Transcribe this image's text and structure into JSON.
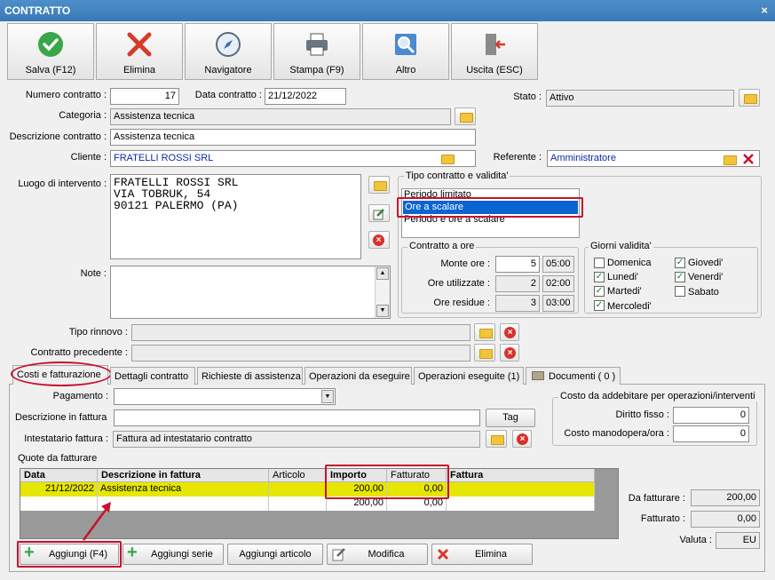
{
  "window": {
    "title": "CONTRATTO",
    "close": "×"
  },
  "toolbar": {
    "save": "Salva (F12)",
    "delete": "Elimina",
    "navigator": "Navigatore",
    "print": "Stampa (F9)",
    "other": "Altro",
    "exit": "Uscita (ESC)"
  },
  "form": {
    "numero_label": "Numero contratto :",
    "numero_value": "17",
    "data_label": "Data contratto :",
    "data_value": "21/12/2022",
    "stato_label": "Stato :",
    "stato_value": "Attivo",
    "categoria_label": "Categoria :",
    "categoria_value": "Assistenza tecnica",
    "descrizione_label": "Descrizione contratto :",
    "descrizione_value": "Assistenza tecnica",
    "cliente_label": "Cliente :",
    "cliente_value": "FRATELLI ROSSI SRL",
    "referente_label": "Referente :",
    "referente_value": "Amministratore",
    "luogo_label": "Luogo di intervento :",
    "luogo_lines": [
      "FRATELLI ROSSI SRL",
      "VIA TOBRUK, 54",
      "90121 PALERMO (PA)"
    ],
    "note_label": "Note :",
    "tipo_rinnovo_label": "Tipo rinnovo :",
    "contratto_precedente_label": "Contratto precedente :"
  },
  "tipo_contratto": {
    "title": "Tipo contratto e validita'",
    "options": [
      "Periodo limitato",
      "Ore a scalare",
      "Periodo e ore a scalare"
    ],
    "selected": "Ore a scalare"
  },
  "contratto_ore": {
    "title": "Contratto a ore",
    "monte_label": "Monte ore :",
    "monte_value": "5",
    "monte_time": "05:00",
    "utilizzate_label": "Ore utilizzate :",
    "utilizzate_value": "2",
    "utilizzate_time": "02:00",
    "residue_label": "Ore residue :",
    "residue_value": "3",
    "residue_time": "03:00"
  },
  "giorni": {
    "title": "Giorni validita'",
    "days": [
      {
        "label": "Domenica",
        "checked": false
      },
      {
        "label": "Lunedi'",
        "checked": true
      },
      {
        "label": "Martedi'",
        "checked": true
      },
      {
        "label": "Mercoledi'",
        "checked": true
      },
      {
        "label": "Giovedi'",
        "checked": true
      },
      {
        "label": "Venerdi'",
        "checked": true
      },
      {
        "label": "Sabato",
        "checked": false
      }
    ],
    "check_mark": "✓"
  },
  "tabs": [
    "Costi e fatturazione",
    "Dettagli contratto",
    "Richieste di assistenza",
    "Operazioni da eseguire",
    "Operazioni eseguite (1)",
    "Documenti ( 0 )"
  ],
  "billing": {
    "pagamento_label": "Pagamento :",
    "descrizione_label": "Descrizione in fattura",
    "tag_button": "Tag",
    "intestatario_label": "Intestatario fattura :",
    "intestatario_value": "Fattura ad intestatario contratto",
    "costo_title": "Costo da addebitare per operazioni/interventi",
    "diritto_label": "Diritto fisso :",
    "diritto_value": "0",
    "manodopera_label": "Costo manodopera/ora :",
    "manodopera_value": "0",
    "quote_label": "Quote da fatturare",
    "columns": [
      "Data",
      "Descrizione in fattura",
      "Articolo",
      "Importo",
      "Fatturato",
      "Fattura"
    ],
    "rows": [
      {
        "data": "21/12/2022",
        "descrizione": "Assistenza tecnica",
        "articolo": "",
        "importo": "200,00",
        "fatturato": "0,00",
        "fattura": ""
      },
      {
        "data": "",
        "descrizione": "",
        "articolo": "",
        "importo": "200,00",
        "fatturato": "0,00",
        "fattura": ""
      }
    ],
    "da_fatturare_label": "Da fatturare :",
    "da_fatturare_value": "200,00",
    "fatturato_label": "Fatturato :",
    "fatturato_value": "0,00",
    "valuta_label": "Valuta :",
    "valuta_value": "EU"
  },
  "bottom_buttons": {
    "add": "Aggiungi (F4)",
    "add_series": "Aggiungi serie",
    "add_article": "Aggiungi articolo",
    "edit": "Modifica",
    "delete": "Elimina"
  },
  "colors": {
    "title_bar": "#3a78b5",
    "highlight_row": "#e6e600",
    "selection": "#0a64d2",
    "annotation_red": "#c8102e"
  }
}
